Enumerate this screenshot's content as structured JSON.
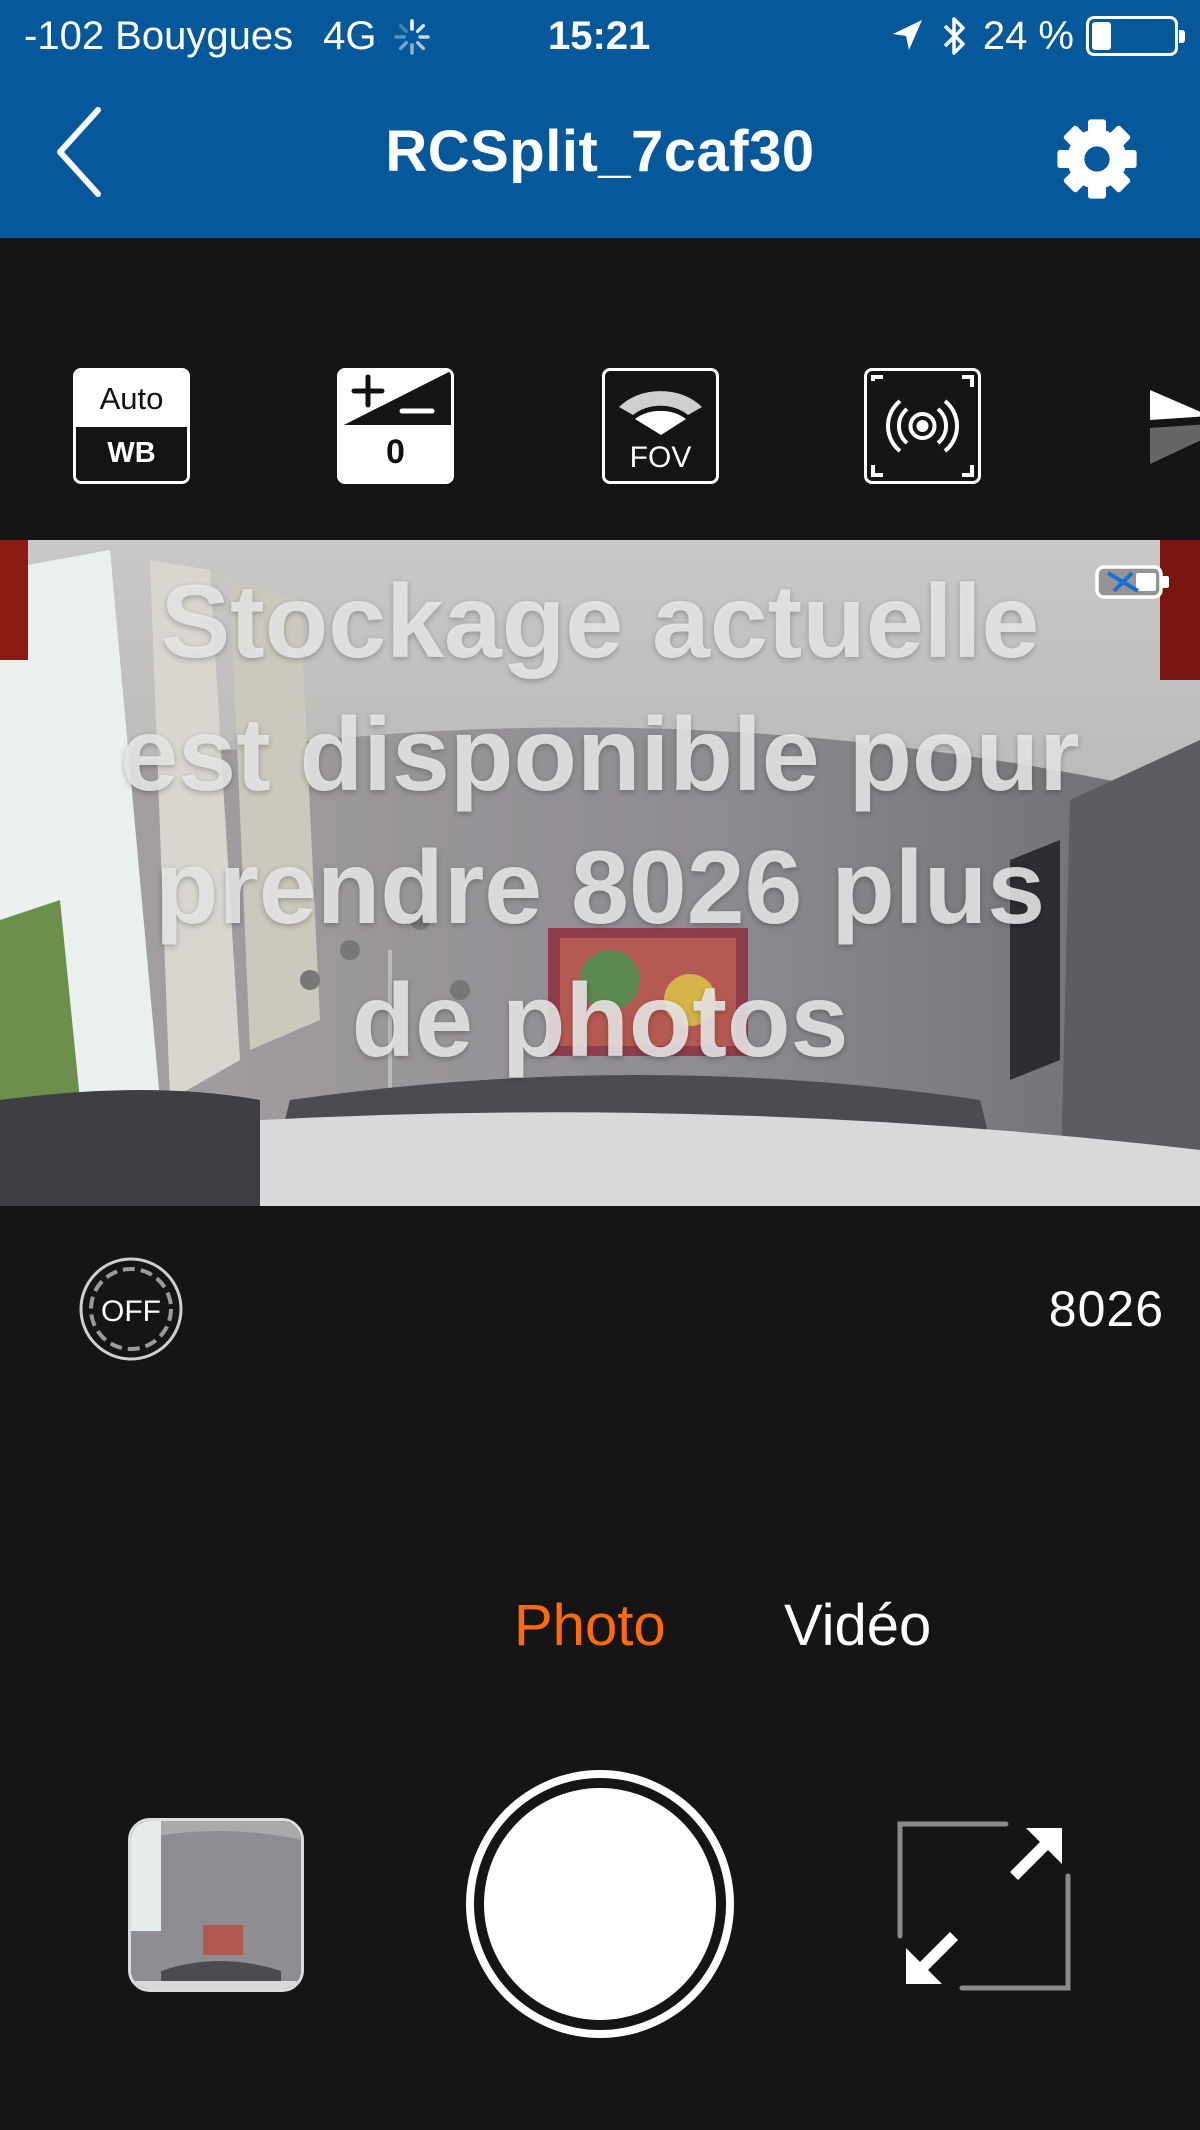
{
  "status_bar": {
    "carrier": "-102 Bouygues",
    "network": "4G",
    "time": "15:21",
    "battery_text": "24 %",
    "battery_level": 0.24,
    "icons": [
      "loading-spinner-icon",
      "location-arrow-icon",
      "bluetooth-icon",
      "battery-icon"
    ]
  },
  "nav": {
    "title": "RCSplit_7caf30",
    "back_icon": "chevron-left-icon",
    "settings_icon": "gear-icon"
  },
  "settings": {
    "white_balance": {
      "top": "Auto",
      "bottom": "WB"
    },
    "exposure": {
      "value": "0",
      "icon": "exposure-plus-minus-icon"
    },
    "fov": {
      "label": "FOV",
      "icon": "wide-angle-icon"
    },
    "metering_icon": "spot-metering-icon",
    "more_icon": "next-setting-icon"
  },
  "preview": {
    "overlay_message": "Stockage actuelle est disponible pour prendre 8026 plus de photos",
    "camera_battery_icon": "camera-battery-charging-icon"
  },
  "controls": {
    "timer_label": "OFF",
    "remaining_count": "8026",
    "modes": [
      "Photo",
      "Vidéo"
    ],
    "active_mode": "Photo",
    "accent_color": "#ff6a0a",
    "header_color": "#05599b",
    "gallery_icon": "gallery-thumbnail",
    "shutter_icon": "shutter-button",
    "fullscreen_icon": "expand-arrows-icon"
  }
}
